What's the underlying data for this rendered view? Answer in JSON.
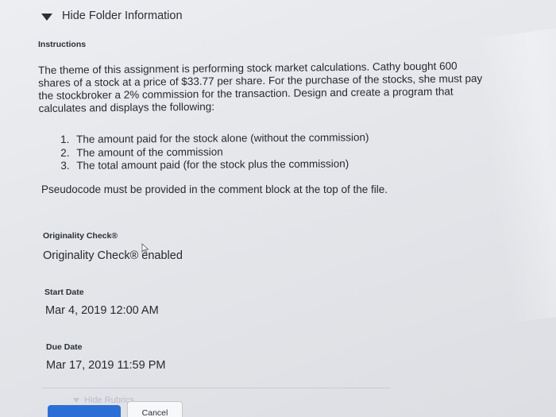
{
  "folder_toggle": {
    "label": "Hide Folder Information",
    "icon": "caret-down-icon"
  },
  "instructions": {
    "heading": "Instructions",
    "paragraph": "The theme of this assignment is performing stock market calculations. Cathy bought 600 shares of a stock at a price of $33.77 per share. For the purchase of the stocks, she must pay the stockbroker a 2% commission for the transaction. Design and create a program that calculates and displays the following:",
    "list": [
      {
        "num": "1.",
        "text": "The amount paid for the stock alone (without the commission)"
      },
      {
        "num": "2.",
        "text": "The amount of the commission"
      },
      {
        "num": "3.",
        "text": "The total amount paid (for the stock plus the commission)"
      }
    ],
    "note": "Pseudocode must be provided in the comment block at the top of the file."
  },
  "originality": {
    "heading": "Originality Check®",
    "value": "Originality Check® enabled"
  },
  "start_date": {
    "heading": "Start Date",
    "value": "Mar 4, 2019 12:00 AM"
  },
  "due_date": {
    "heading": "Due Date",
    "value": "Mar 17, 2019 11:59 PM"
  },
  "footer": {
    "hide_rubrics_label": "Hide Rubrics",
    "cancel_label": "Cancel",
    "submit_color": "#2b6fd6"
  }
}
